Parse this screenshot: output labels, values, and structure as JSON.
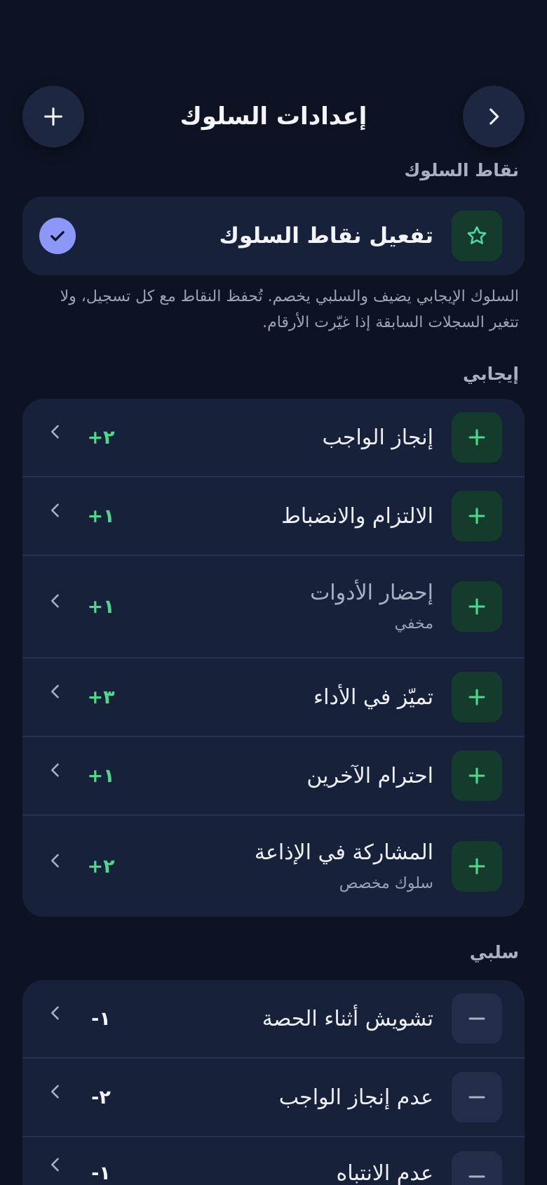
{
  "header": {
    "title": "إعدادات السلوك"
  },
  "sections": {
    "points_label": "نقاط السلوك",
    "positive_label": "إيجابي",
    "negative_label": "سلبي"
  },
  "enable": {
    "title": "تفعيل نقاط السلوك",
    "enabled": true
  },
  "description_line1": "السلوك الإيجابي يضيف والسلبي يخصم. تُحفظ النقاط مع كل تسجيل، ولا",
  "description_line2": "تتغير السجلات السابقة إذا غيّرت الأرقام.",
  "positive": [
    {
      "title": "إنجاز الواجب",
      "points": "٢+"
    },
    {
      "title": "الالتزام والانضباط",
      "points": "١+"
    },
    {
      "title": "إحضار الأدوات",
      "subtitle": "مخفي",
      "points": "١+"
    },
    {
      "title": "تميّز في الأداء",
      "points": "٣+"
    },
    {
      "title": "احترام الآخرين",
      "points": "١+"
    },
    {
      "title": "المشاركة في الإذاعة",
      "subtitle": "سلوك مخصص",
      "points": "٢+"
    }
  ],
  "negative": [
    {
      "title": "تشويش أثناء الحصة",
      "points": "١-"
    },
    {
      "title": "عدم إنجاز الواجب",
      "points": "٢-"
    },
    {
      "title": "عدم الانتباه",
      "points": "١-"
    }
  ],
  "colors": {
    "background": "#0d1322",
    "card": "#18213a",
    "accent_green": "#4fd88c",
    "check_purple": "#8d97f7"
  }
}
